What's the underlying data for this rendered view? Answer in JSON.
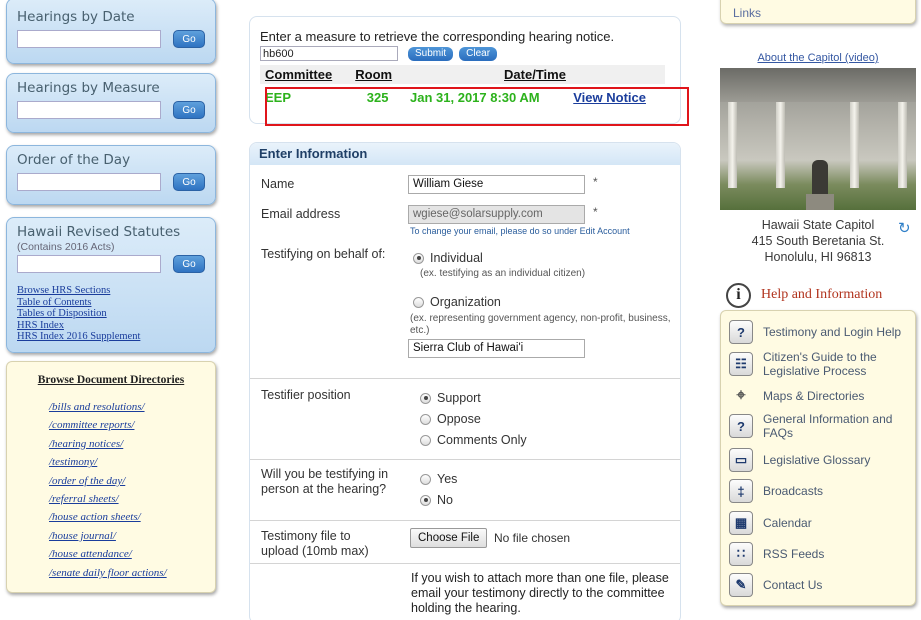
{
  "left": {
    "hearings_by_date": {
      "title": "Hearings by Date",
      "go": "Go"
    },
    "hearings_by_measure": {
      "title": "Hearings by Measure",
      "go": "Go"
    },
    "order_of_day": {
      "title": "Order of the Day",
      "go": "Go"
    },
    "hrs": {
      "title": "Hawaii Revised Statutes",
      "subtitle": "(Contains 2016 Acts)",
      "go": "Go",
      "links": [
        "Browse HRS Sections",
        "Table of Contents",
        "Tables of Disposition",
        "HRS Index",
        "HRS Index 2016 Supplement"
      ]
    },
    "browse": {
      "title": "Browse Document Directories",
      "items": [
        "/bills and resolutions/",
        "/committee reports/",
        "/hearing notices/",
        "/testimony/",
        "/order of the day/",
        "/referral sheets/",
        "/house action sheets/",
        "/house journal/",
        "/house attendance/",
        "/senate daily floor actions/"
      ]
    }
  },
  "measure": {
    "prompt": "Enter a measure to retrieve the corresponding hearing notice.",
    "input_value": "hb600",
    "submit": "Submit",
    "clear": "Clear",
    "headers": {
      "committee": "Committee",
      "room": "Room",
      "datetime": "Date/Time"
    },
    "result": {
      "committee": "EEP",
      "room": "325",
      "datetime": "Jan 31, 2017 8:30 AM",
      "link": "View Notice"
    }
  },
  "info": {
    "header": "Enter Information",
    "name_label": "Name",
    "name_value": "William Giese",
    "email_label": "Email address",
    "email_value": "wgiese@solarsupply.com",
    "email_note": "To change your email, please do so under Edit Account",
    "required_mark": "*",
    "behalf_label": "Testifying on behalf of:",
    "individual": "Individual",
    "individual_example": "(ex. testifying as an individual citizen)",
    "organization": "Organization",
    "organization_example": "(ex. representing government agency, non-profit, business, etc.)",
    "organization_value": "Sierra Club of Hawai'i",
    "position_label": "Testifier position",
    "position_options": [
      "Support",
      "Oppose",
      "Comments Only"
    ],
    "position_selected": "Support",
    "in_person_label": "Will you be testifying in person at the hearing?",
    "in_person_options": [
      "Yes",
      "No"
    ],
    "in_person_selected": "No",
    "file_label": "Testimony file to upload (10mb max)",
    "file_button": "Choose File",
    "file_status": "No file chosen",
    "multi_note": "If you wish to attach more than one file, please email your testimony directly to the committee holding the hearing."
  },
  "right": {
    "links_title": "Links",
    "about_link": "About the Capitol (video)",
    "capitol_name": "Hawaii State Capitol",
    "capitol_street": "415 South Beretania St.",
    "capitol_city": "Honolulu, HI 96813",
    "help_title": "Help and Information",
    "help_items": [
      {
        "label": "Testimony and Login Help",
        "icon": "question-icon"
      },
      {
        "label": "Citizen's Guide to the Legislative Process",
        "icon": "book-icon"
      },
      {
        "label": "Maps & Directories",
        "icon": "compass-icon"
      },
      {
        "label": "General Information and FAQs",
        "icon": "question-icon"
      },
      {
        "label": "Legislative Glossary",
        "icon": "open-book-icon"
      },
      {
        "label": "Broadcasts",
        "icon": "antenna-icon"
      },
      {
        "label": "Calendar",
        "icon": "calendar-icon"
      },
      {
        "label": "RSS Feeds",
        "icon": "rss-icon"
      },
      {
        "label": "Contact Us",
        "icon": "pen-icon"
      }
    ]
  }
}
